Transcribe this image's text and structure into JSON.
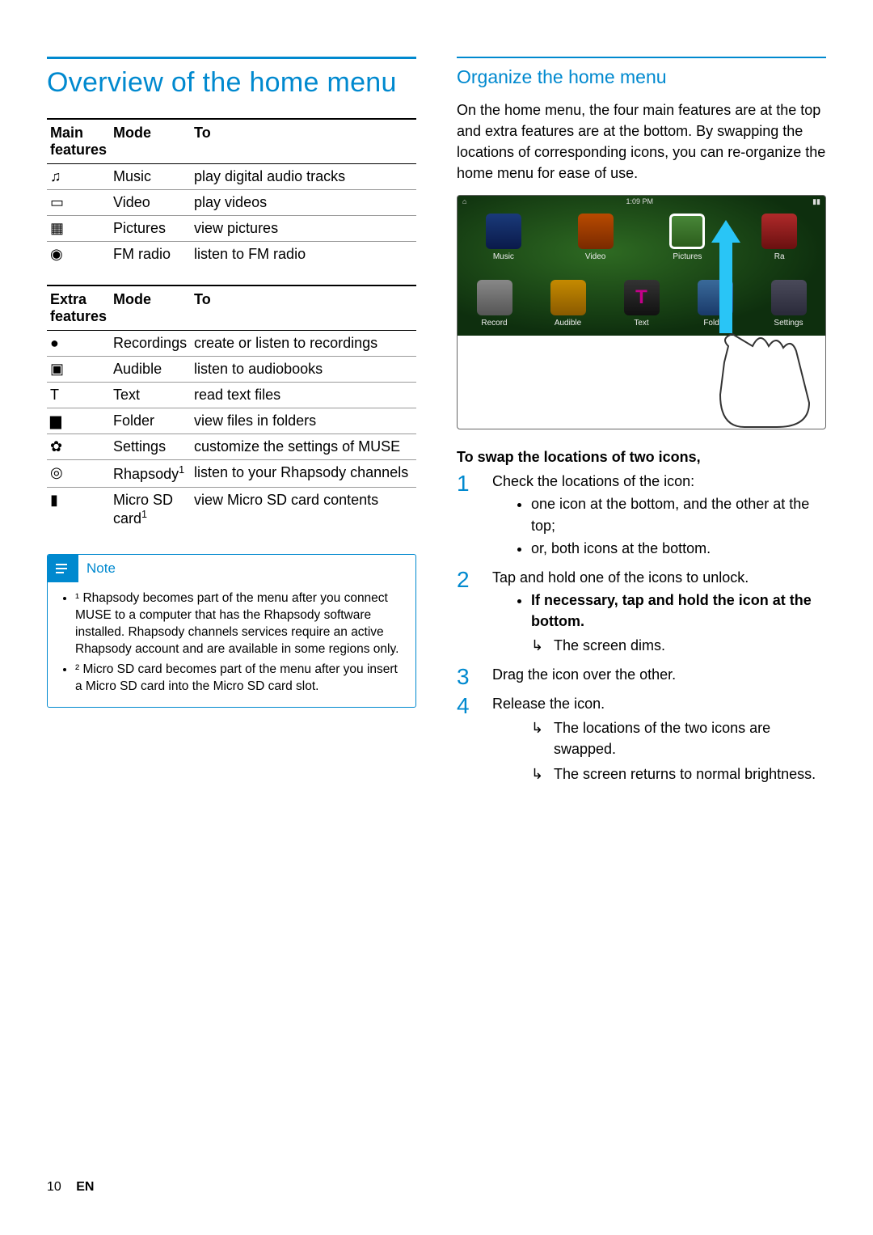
{
  "page_title": "Overview of the home menu",
  "table_main": {
    "headers": [
      "Main features",
      "Mode",
      "To"
    ],
    "rows": [
      {
        "icon": "music-icon",
        "glyph": "♫",
        "mode": "Music",
        "to": "play digital audio tracks"
      },
      {
        "icon": "video-icon",
        "glyph": "▭",
        "mode": "Video",
        "to": "play videos"
      },
      {
        "icon": "pictures-icon",
        "glyph": "▦",
        "mode": "Pictures",
        "to": "view pictures"
      },
      {
        "icon": "radio-icon",
        "glyph": "◉",
        "mode": "FM radio",
        "to": "listen to FM radio"
      }
    ]
  },
  "table_extra": {
    "headers": [
      "Extra features",
      "Mode",
      "To"
    ],
    "rows": [
      {
        "icon": "recordings-icon",
        "glyph": "●",
        "mode": "Recordings",
        "to": "create or listen to recordings"
      },
      {
        "icon": "audible-icon",
        "glyph": "▣",
        "mode": "Audible",
        "to": "listen to audiobooks"
      },
      {
        "icon": "text-icon",
        "glyph": "T",
        "mode": "Text",
        "to": "read text files"
      },
      {
        "icon": "folder-icon",
        "glyph": "▆",
        "mode": "Folder",
        "to": "view files in folders"
      },
      {
        "icon": "settings-icon",
        "glyph": "✿",
        "mode": "Settings",
        "to": "customize the settings of MUSE"
      },
      {
        "icon": "rhapsody-icon",
        "glyph": "◎",
        "mode": "Rhapsody",
        "mode_sup": "1",
        "to": "listen to your Rhapsody channels"
      },
      {
        "icon": "sdcard-icon",
        "glyph": "▮",
        "mode": "Micro SD card",
        "mode_sup": "1",
        "to": "view Micro SD card contents"
      }
    ]
  },
  "note": {
    "label": "Note",
    "items": [
      "¹ Rhapsody becomes part of the menu after you connect MUSE to a computer that has the Rhapsody software installed. Rhapsody channels services require an active Rhapsody account and are available in some regions only.",
      "² Micro SD card becomes part of the menu after you insert a Micro SD card into the Micro SD card slot."
    ]
  },
  "right": {
    "section_title": "Organize the home menu",
    "intro": "On the home menu, the four main features are at the top and extra features are at the bottom. By swapping the locations of corresponding icons, you can re-organize the home menu for ease of use.",
    "screenshot": {
      "time": "1:09 PM",
      "row_top": [
        "Music",
        "Video",
        "Pictures",
        "Ra"
      ],
      "row_bot": [
        "Record",
        "Audible",
        "Text",
        "Folder",
        "Settings"
      ]
    },
    "swap_heading": "To swap the locations of two icons,",
    "steps": [
      {
        "text": "Check the locations of the icon:",
        "sub_bullets": [
          "one icon at the bottom, and the other at the top;",
          "or, both icons at the bottom."
        ]
      },
      {
        "text": "Tap and hold one of the icons to unlock.",
        "sub_bullets_bold": [
          "If necessary, tap and hold the icon at the bottom."
        ],
        "results": [
          "The screen dims."
        ]
      },
      {
        "text": "Drag the icon over the other."
      },
      {
        "text": "Release the icon.",
        "results": [
          "The locations of the two icons are swapped.",
          "The screen returns to normal brightness."
        ]
      }
    ]
  },
  "footer": {
    "page_number": "10",
    "lang": "EN"
  }
}
